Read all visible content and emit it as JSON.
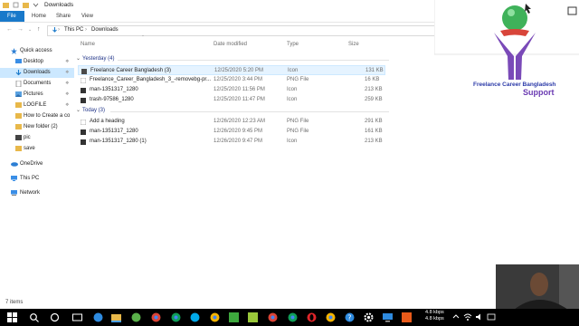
{
  "window": {
    "title": "Downloads"
  },
  "ribbon": {
    "tabs": [
      "File",
      "Home",
      "Share",
      "View"
    ]
  },
  "address": {
    "path": [
      "This PC",
      "Downloads"
    ]
  },
  "nav": {
    "items": [
      {
        "label": "Quick access",
        "icon": "star-icon",
        "pinned": false
      },
      {
        "label": "Desktop",
        "icon": "desktop-icon",
        "pinned": true
      },
      {
        "label": "Downloads",
        "icon": "download-icon",
        "pinned": true,
        "selected": true
      },
      {
        "label": "Documents",
        "icon": "documents-icon",
        "pinned": true
      },
      {
        "label": "Pictures",
        "icon": "pictures-icon",
        "pinned": true
      },
      {
        "label": "LOGFILE",
        "icon": "folder-icon",
        "pinned": true
      },
      {
        "label": "How to Create a co",
        "icon": "folder-icon",
        "pinned": false
      },
      {
        "label": "New folder (2)",
        "icon": "folder-icon",
        "pinned": false
      },
      {
        "label": "pic",
        "icon": "folder-icon",
        "pinned": false
      },
      {
        "label": "save",
        "icon": "folder-icon",
        "pinned": false
      },
      {
        "label": "OneDrive",
        "icon": "cloud-icon",
        "pinned": false
      },
      {
        "label": "This PC",
        "icon": "computer-icon",
        "pinned": false
      },
      {
        "label": "Network",
        "icon": "network-icon",
        "pinned": false
      }
    ]
  },
  "columns": {
    "name": "Name",
    "date": "Date modified",
    "type": "Type",
    "size": "Size"
  },
  "groups": [
    {
      "label": "Yesterday (4)",
      "files": [
        {
          "name": "Freelance Career Bangladesh (3)",
          "date": "12/25/2020 5:20 PM",
          "type": "Icon",
          "size": "131 KB",
          "icon": "icon-file-icon",
          "selected": true
        },
        {
          "name": "Freelance_Career_Bangladesh_3_-removebg-pr...",
          "date": "12/25/2020 3:44 PM",
          "type": "PNG File",
          "size": "16 KB",
          "icon": "png-file-icon"
        },
        {
          "name": "man-1351317_1280",
          "date": "12/25/2020 11:56 PM",
          "type": "Icon",
          "size": "213 KB",
          "icon": "icon-file-icon"
        },
        {
          "name": "trash-97586_1280",
          "date": "12/25/2020 11:47 PM",
          "type": "Icon",
          "size": "259 KB",
          "icon": "icon-file-icon"
        }
      ]
    },
    {
      "label": "Today (3)",
      "files": [
        {
          "name": "Add a heading",
          "date": "12/26/2020 12:23 AM",
          "type": "PNG File",
          "size": "291 KB",
          "icon": "png-file-icon"
        },
        {
          "name": "man-1351317_1280",
          "date": "12/26/2020 9:45 PM",
          "type": "PNG File",
          "size": "161 KB",
          "icon": "png-file-icon"
        },
        {
          "name": "man-1351317_1280 (1)",
          "date": "12/26/2020 9:47 PM",
          "type": "Icon",
          "size": "213 KB",
          "icon": "icon-file-icon"
        }
      ]
    }
  ],
  "status": {
    "items": "7 items"
  },
  "logo": {
    "caption": "Freelance Career Bangladesh",
    "sub": "Support"
  },
  "tray": {
    "up": "4.8 kbps",
    "down": "4.8 kbps"
  },
  "colors": {
    "accent": "#1979ca",
    "selection": "#cce8ff",
    "group": "#1e3287",
    "folder": "#e8b84a"
  }
}
